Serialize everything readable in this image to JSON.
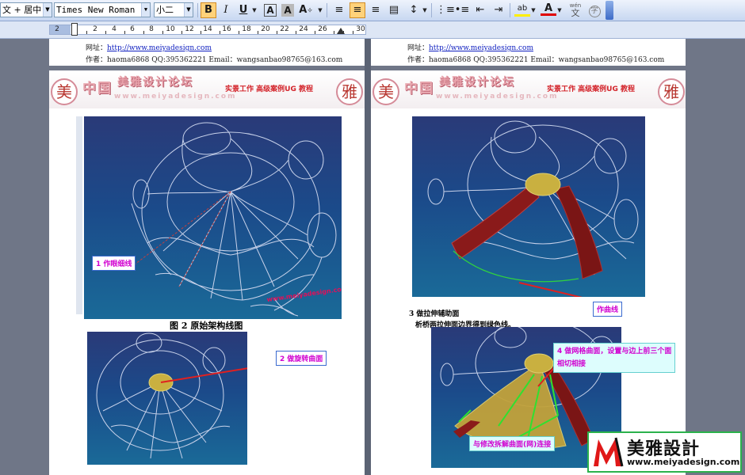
{
  "toolbar": {
    "style_value": "文 + 居中",
    "font_value": "Times New Roman",
    "size_value": "小二",
    "bold": "B",
    "italic": "I",
    "underline": "U",
    "char_border": "A",
    "char_shade": "A",
    "phonetic": "wén",
    "enclose": "字"
  },
  "ruler": {
    "ticks": [
      "2",
      "2",
      "4",
      "6",
      "8",
      "10",
      "12",
      "14",
      "16",
      "18",
      "20",
      "22",
      "24",
      "26",
      "30"
    ]
  },
  "page_top": {
    "website_label": "网址：",
    "website_url": "http://www.meiyadesign.com",
    "author_line": "作者：haoma6868 QQ:395362221   Email：wangsanbao98765@163.com"
  },
  "header": {
    "seal_left": "美",
    "seal_right": "雅",
    "title_cn": "中国",
    "title_site": "美雅设计论坛",
    "url": "www.meiyadesign.com",
    "subtitle": "实景工作 高级案例UG 教程"
  },
  "left_page": {
    "callout_1": "1 作眼细线",
    "watermark": "www.meiyadesign.com",
    "caption": "图 2 原始架构线图",
    "callout_2": "2 做旋转曲面"
  },
  "right_page": {
    "callout_guide": "作曲线",
    "step3_line1": "3 做拉伸辅助面",
    "step3_line2": "析桥两拉伸面边界得到绿色线。",
    "callout_4a": "4 做网格曲面，设置与边上前三个面",
    "callout_4b": "相切相接",
    "callout_4c": "与修改拆解曲面(网)连接"
  },
  "logo": {
    "name": "美雅設計",
    "url": "www.meiyadesign.com"
  },
  "colors": {
    "accent_magenta": "#d100d0",
    "cad_top": "#2a3a78",
    "cad_bottom": "#1a6a98"
  }
}
